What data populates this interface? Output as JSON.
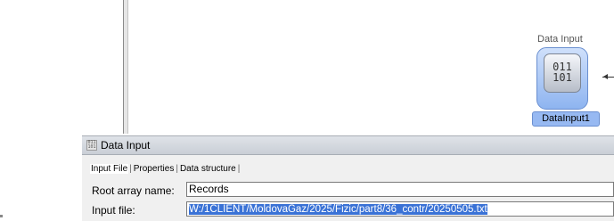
{
  "canvas": {
    "node": {
      "caption": "Data Input",
      "icon_line1": "011",
      "icon_line2": "101",
      "label": "DataInput1"
    }
  },
  "panel": {
    "title": "Data Input",
    "tabs": [
      {
        "label": "Input File",
        "active": true
      },
      {
        "label": "Properties",
        "active": false
      },
      {
        "label": "Data structure",
        "active": false
      }
    ],
    "root_array_label": "Root array name:",
    "root_array_value": "Records",
    "input_file_label": "Input file:",
    "input_file_value": "W:/1CLIENT/MoldovaGaz/2025/Fizic/part8/36_contr/20250505.txt"
  }
}
